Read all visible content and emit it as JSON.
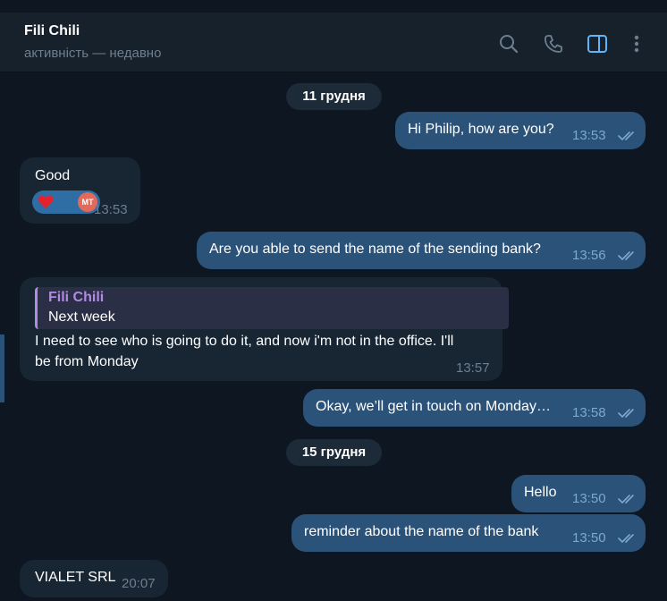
{
  "header": {
    "title": "Fili Chili",
    "subtitle": "активність — недавно",
    "icons": [
      "search-icon",
      "phone-icon",
      "sidebar-toggle-icon",
      "more-vertical-icon"
    ]
  },
  "chat": {
    "dates": [
      "11 грудня",
      "15 грудня"
    ],
    "messages": [
      {
        "dir": "out",
        "text": "Hi Philip, how are you?",
        "time": "13:53",
        "read": true
      },
      {
        "dir": "in",
        "text": "Good",
        "time": "13:53",
        "reactions": [
          "heart",
          "MT"
        ]
      },
      {
        "dir": "out",
        "text": "Are you able to send the name of the sending bank?",
        "time": "13:56",
        "read": true
      },
      {
        "dir": "in",
        "reply": {
          "name": "Fili Chili",
          "text": "Next week"
        },
        "line1": "I need to see who is going to do it, and now i'm not in the office. I'll",
        "line2": "be from Monday",
        "time": "13:57"
      },
      {
        "dir": "out",
        "text": "Okay, we’ll get in touch on Monday…",
        "time": "13:58",
        "read": true
      },
      {
        "dir": "out",
        "text": "Hello",
        "time": "13:50",
        "read": true
      },
      {
        "dir": "out",
        "text": "reminder about the name of the bank",
        "time": "13:50",
        "read": true
      },
      {
        "dir": "in",
        "text": "VIALET SRL",
        "time": "20:07"
      }
    ]
  },
  "colors": {
    "background": "#0e1621",
    "header": "#17212b",
    "outgoing": "#2b5278",
    "incoming": "#182533",
    "accent": "#5eb5f7",
    "reply_accent": "#b18ae3"
  }
}
